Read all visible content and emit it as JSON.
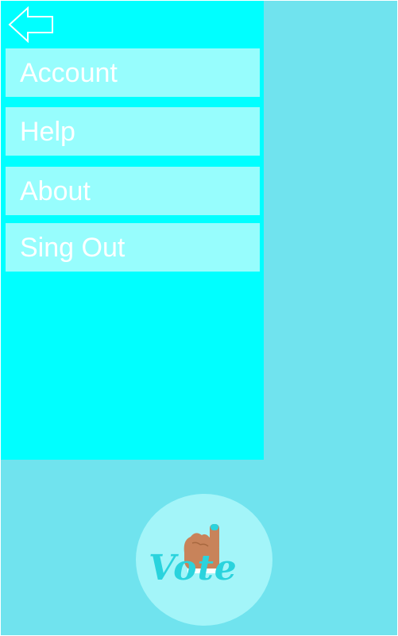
{
  "drawer": {
    "back_icon": "back-arrow-icon",
    "items": [
      {
        "label": "Account"
      },
      {
        "label": "Help"
      },
      {
        "label": "About"
      },
      {
        "label": "Sing Out"
      }
    ]
  },
  "logo": {
    "text": "Vote",
    "icon": "voting-finger-hand-icon"
  },
  "colors": {
    "background": "#70e3ee",
    "drawer": "#00ffff",
    "menu_item": "#97fdfd",
    "menu_text": "#ffffff",
    "logo_circle": "#a3f5f9",
    "logo_text": "#2ad3dd",
    "hand": "#c8835a"
  }
}
